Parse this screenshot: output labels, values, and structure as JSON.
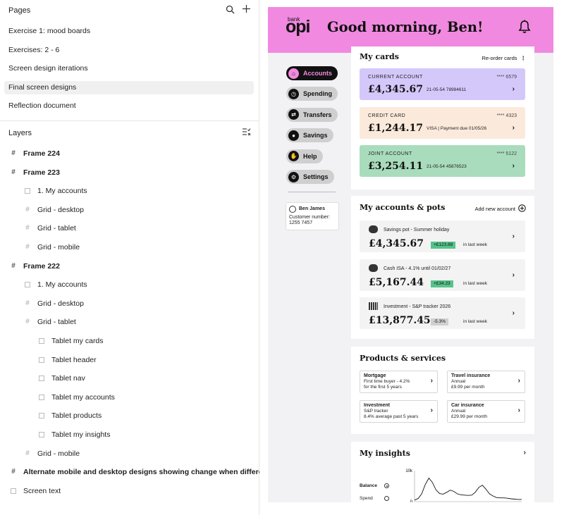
{
  "pages": {
    "title": "Pages",
    "items": [
      {
        "label": "Exercise 1: mood boards"
      },
      {
        "label": "Exercises: 2 - 6"
      },
      {
        "label": "Screen design iterations"
      },
      {
        "label": "Final screen designs",
        "active": true
      },
      {
        "label": "Reflection document"
      }
    ]
  },
  "layers": {
    "title": "Layers",
    "items": [
      {
        "label": "Frame 224",
        "kind": "frame"
      },
      {
        "label": "Frame 223",
        "kind": "frame"
      },
      {
        "label": "1. My accounts",
        "kind": "rect"
      },
      {
        "label": "Grid - desktop",
        "kind": "grid"
      },
      {
        "label": "Grid - tablet",
        "kind": "grid"
      },
      {
        "label": "Grid - mobile",
        "kind": "grid"
      },
      {
        "label": "Frame 222",
        "kind": "frame"
      },
      {
        "label": "1. My accounts",
        "kind": "rect"
      },
      {
        "label": "Grid - desktop",
        "kind": "grid"
      },
      {
        "label": "Grid - tablet",
        "kind": "grid"
      },
      {
        "label": "Tablet my cards",
        "kind": "rect"
      },
      {
        "label": "Tablet header",
        "kind": "rect"
      },
      {
        "label": "Tablet nav",
        "kind": "rect"
      },
      {
        "label": "Tablet my accounts",
        "kind": "rect"
      },
      {
        "label": "Tablet products",
        "kind": "rect"
      },
      {
        "label": "Tablet my insights",
        "kind": "rect"
      },
      {
        "label": "Grid - mobile",
        "kind": "grid"
      },
      {
        "label": "Alternate mobile and desktop designs showing change when different card",
        "kind": "frame"
      },
      {
        "label": "Screen text",
        "kind": "rect"
      }
    ]
  },
  "app": {
    "brand_small": "bank",
    "brand_big": "opi",
    "greeting": "Good morning, Ben!",
    "colors": {
      "brand": "#f189e0",
      "current": "#d4c8fb",
      "credit": "#fbeadb",
      "joint": "#a9dcbc",
      "up": "#56c48a"
    },
    "nav": [
      {
        "label": "Accounts",
        "icon": "home-icon",
        "active": true
      },
      {
        "label": "Spending",
        "icon": "clock-icon"
      },
      {
        "label": "Transfers",
        "icon": "transfer-icon"
      },
      {
        "label": "Savings",
        "icon": "piggy-bank-icon"
      },
      {
        "label": "Help",
        "icon": "hand-icon"
      },
      {
        "label": "Settings",
        "icon": "gear-icon"
      }
    ],
    "user": {
      "name": "Ben James",
      "customer_label": "Customer number:",
      "customer_number": "1255 7457"
    },
    "my_cards": {
      "title": "My cards",
      "action": "Re-order cards",
      "cards": [
        {
          "type": "CURRENT ACCOUNT",
          "mask": "**** 6579",
          "balance": "£4,345.67",
          "info": "21-05-54 78984611"
        },
        {
          "type": "CREDIT CARD",
          "mask": "**** 4323",
          "balance": "£1,244.17",
          "info": "VISA | Payment due 01/05/26"
        },
        {
          "type": "JOINT ACCOUNT",
          "mask": "**** 5122",
          "balance": "£3,254.11",
          "info": "21-05-54 45876523"
        }
      ]
    },
    "accounts_pots": {
      "title": "My accounts & pots",
      "action": "Add new account",
      "items": [
        {
          "name": "Savings pot - Summer holiday",
          "balance": "£4,345.67",
          "change": "+£123.88",
          "direction": "up",
          "period": "in last week",
          "icon": "piggy-bank-icon"
        },
        {
          "name": "Cash ISA - 4.1% until 01/02/27",
          "balance": "£5,167.44",
          "change": "+£34.23",
          "direction": "up",
          "period": "in last week",
          "icon": "piggy-bank-icon"
        },
        {
          "name": "Investment - S&P tracker 2026",
          "balance": "£13,877.45",
          "change": "-5.3%",
          "direction": "down",
          "period": "in last week",
          "icon": "bar-chart-icon"
        }
      ]
    },
    "products": {
      "title": "Products & services",
      "items": [
        {
          "title": "Mortgage",
          "line1": "First time buyer - 4.2%",
          "line2": "for the first 5 years"
        },
        {
          "title": "Travel insurance",
          "line1": "Annual",
          "line2": "£9.99 per month"
        },
        {
          "title": "Investment",
          "line1": "S&P tracker",
          "line2": "8.4% average past 5 years"
        },
        {
          "title": "Car insurance",
          "line1": "Annual",
          "line2": "£29.99 per month"
        }
      ]
    },
    "insights": {
      "title": "My insights",
      "options": [
        {
          "label": "Balance",
          "selected": true
        },
        {
          "label": "Spend",
          "selected": false
        }
      ]
    }
  },
  "chart_data": {
    "type": "line",
    "title": "",
    "xlabel": "",
    "ylabel": "",
    "ylim": [
      0,
      10000
    ],
    "yticks": [
      "0",
      "10k"
    ],
    "x": [
      0,
      1,
      2,
      3,
      4,
      5,
      6,
      7,
      8,
      9,
      10,
      11,
      12,
      13,
      14,
      15,
      16,
      17,
      18,
      19,
      20,
      21,
      22,
      23,
      24,
      25,
      26,
      27,
      28,
      29,
      30
    ],
    "series": [
      {
        "values": [
          500,
          1000,
          2500,
          5500,
          7600,
          6200,
          3800,
          2600,
          2400,
          3000,
          3700,
          3300,
          2500,
          2200,
          2100,
          2000,
          2100,
          3000,
          4600,
          5300,
          4000,
          2500,
          1800,
          1300,
          1200,
          1200,
          1100,
          900,
          800,
          700,
          700
        ]
      }
    ],
    "color": "#111111"
  }
}
